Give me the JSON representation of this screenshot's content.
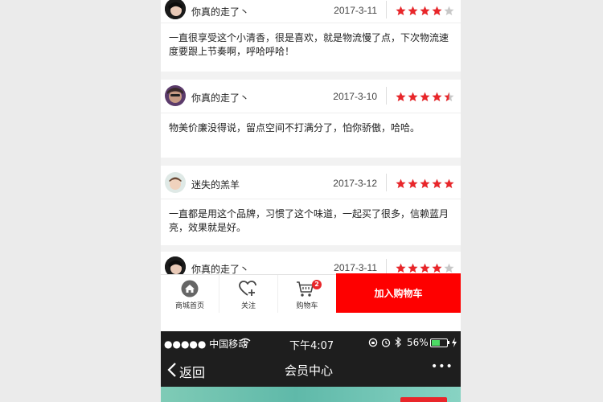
{
  "reviews": [
    {
      "username": "你真的走了丶",
      "date": "2017-3-11",
      "rating": 4,
      "text": "一直很享受这个小清香，很是喜欢，就是物流慢了点，下次物流速度要跟上节奏啊，呼哈呼哈！"
    },
    {
      "username": "你真的走了丶",
      "date": "2017-3-10",
      "rating": 4.5,
      "text": "物美价廉没得说，留点空间不打满分了，怕你骄傲，哈哈。"
    },
    {
      "username": "迷失的羔羊",
      "date": "2017-3-12",
      "rating": 5,
      "text": "一直都是用这个品牌，习惯了这个味道，一起买了很多，信赖蓝月亮，效果就是好。"
    },
    {
      "username": "你真的走了丶",
      "date": "2017-3-11",
      "rating": 4,
      "text": ""
    }
  ],
  "tabbar": {
    "home_label": "商城首页",
    "follow_label": "关注",
    "cart_label": "购物车",
    "cart_badge": "2",
    "add_to_cart_label": "加入购物车"
  },
  "status_bar": {
    "carrier": "●●●●● 中国移动",
    "time": "下午4:07",
    "battery_percent": "56%",
    "battery_level": 0.56
  },
  "nav": {
    "back_label": "返回",
    "title": "会员中心",
    "more_label": "•••"
  },
  "colors": {
    "accent_red": "#fe0000",
    "star_red": "#e9262a",
    "star_empty": "#c8c8c8",
    "status_bar_bg": "#1e1e1e",
    "battery_green": "#4cd964"
  },
  "icons": {
    "home": "home-icon",
    "follow": "heart-plus-icon",
    "cart": "cart-icon",
    "back": "chevron-left-icon",
    "more": "more-dots-icon"
  }
}
